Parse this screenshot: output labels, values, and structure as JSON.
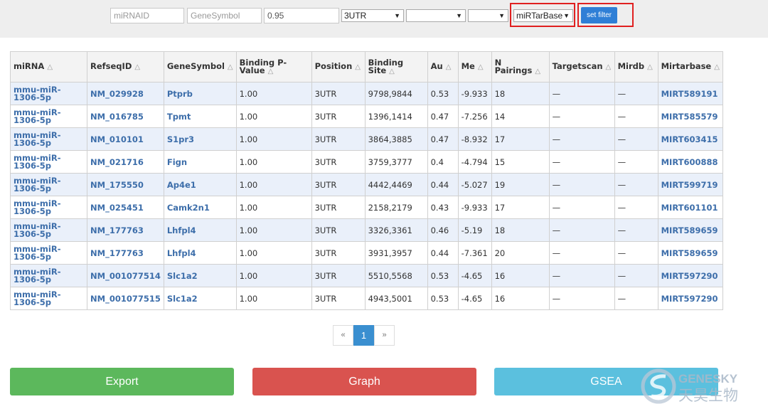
{
  "filters": {
    "mirna_placeholder": "miRNAID",
    "gene_placeholder": "GeneSymbol",
    "pvalue_value": "0.95",
    "position_select": "3UTR",
    "select2": "",
    "select3": "",
    "database_select": "miRTarBase",
    "set_filter_label": "set filter"
  },
  "table": {
    "headers": [
      "miRNA",
      "RefseqID",
      "GeneSymbol",
      "Binding P-Value",
      "Position",
      "Binding Site",
      "Au",
      "Me",
      "N Pairings",
      "Targetscan",
      "Mirdb",
      "Mirtarbase"
    ],
    "rows": [
      [
        "mmu-miR-1306-5p",
        "NM_029928",
        "Ptprb",
        "1.00",
        "3UTR",
        "9798,9844",
        "0.53",
        "-9.933",
        "18",
        "—",
        "—",
        "MIRT589191"
      ],
      [
        "mmu-miR-1306-5p",
        "NM_016785",
        "Tpmt",
        "1.00",
        "3UTR",
        "1396,1414",
        "0.47",
        "-7.256",
        "14",
        "—",
        "—",
        "MIRT585579"
      ],
      [
        "mmu-miR-1306-5p",
        "NM_010101",
        "S1pr3",
        "1.00",
        "3UTR",
        "3864,3885",
        "0.47",
        "-8.932",
        "17",
        "—",
        "—",
        "MIRT603415"
      ],
      [
        "mmu-miR-1306-5p",
        "NM_021716",
        "Fign",
        "1.00",
        "3UTR",
        "3759,3777",
        "0.4",
        "-4.794",
        "15",
        "—",
        "—",
        "MIRT600888"
      ],
      [
        "mmu-miR-1306-5p",
        "NM_175550",
        "Ap4e1",
        "1.00",
        "3UTR",
        "4442,4469",
        "0.44",
        "-5.027",
        "19",
        "—",
        "—",
        "MIRT599719"
      ],
      [
        "mmu-miR-1306-5p",
        "NM_025451",
        "Camk2n1",
        "1.00",
        "3UTR",
        "2158,2179",
        "0.43",
        "-9.933",
        "17",
        "—",
        "—",
        "MIRT601101"
      ],
      [
        "mmu-miR-1306-5p",
        "NM_177763",
        "Lhfpl4",
        "1.00",
        "3UTR",
        "3326,3361",
        "0.46",
        "-5.19",
        "18",
        "—",
        "—",
        "MIRT589659"
      ],
      [
        "mmu-miR-1306-5p",
        "NM_177763",
        "Lhfpl4",
        "1.00",
        "3UTR",
        "3931,3957",
        "0.44",
        "-7.361",
        "20",
        "—",
        "—",
        "MIRT589659"
      ],
      [
        "mmu-miR-1306-5p",
        "NM_001077514",
        "Slc1a2",
        "1.00",
        "3UTR",
        "5510,5568",
        "0.53",
        "-4.65",
        "16",
        "—",
        "—",
        "MIRT597290"
      ],
      [
        "mmu-miR-1306-5p",
        "NM_001077515",
        "Slc1a2",
        "1.00",
        "3UTR",
        "4943,5001",
        "0.53",
        "-4.65",
        "16",
        "—",
        "—",
        "MIRT597290"
      ]
    ]
  },
  "pagination": {
    "prev": "«",
    "current": "1",
    "next": "»"
  },
  "actions": {
    "export_label": "Export",
    "graph_label": "Graph",
    "gsea_label": "GSEA"
  },
  "watermark": {
    "brand": "GENESKY",
    "chinese": "天昊生物"
  },
  "colors": {
    "export": "#5cb85c",
    "graph": "#d9534f",
    "gsea": "#5bc0de",
    "link": "#3d6eaa",
    "highlight": "#e02020"
  }
}
